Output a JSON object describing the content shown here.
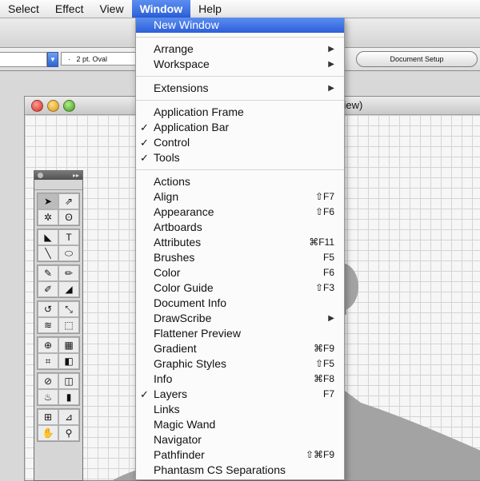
{
  "menubar": {
    "items": [
      "Select",
      "Effect",
      "View",
      "Window",
      "Help"
    ]
  },
  "controlbar": {
    "stroke_label": "2 pt. Oval",
    "document_setup": "Document Setup"
  },
  "document": {
    "title_fragment": "view)"
  },
  "window_menu": {
    "new_window": "New Window",
    "arrange": "Arrange",
    "workspace": "Workspace",
    "extensions": "Extensions",
    "application_frame": "Application Frame",
    "application_bar": "Application Bar",
    "control": "Control",
    "tools": "Tools",
    "panels": [
      {
        "label": "Actions",
        "shortcut": "",
        "checked": false,
        "submenu": false
      },
      {
        "label": "Align",
        "shortcut": "⇧F7",
        "checked": false,
        "submenu": false
      },
      {
        "label": "Appearance",
        "shortcut": "⇧F6",
        "checked": false,
        "submenu": false
      },
      {
        "label": "Artboards",
        "shortcut": "",
        "checked": false,
        "submenu": false
      },
      {
        "label": "Attributes",
        "shortcut": "⌘F11",
        "checked": false,
        "submenu": false
      },
      {
        "label": "Brushes",
        "shortcut": "F5",
        "checked": false,
        "submenu": false
      },
      {
        "label": "Color",
        "shortcut": "F6",
        "checked": false,
        "submenu": false
      },
      {
        "label": "Color Guide",
        "shortcut": "⇧F3",
        "checked": false,
        "submenu": false
      },
      {
        "label": "Document Info",
        "shortcut": "",
        "checked": false,
        "submenu": false
      },
      {
        "label": "DrawScribe",
        "shortcut": "",
        "checked": false,
        "submenu": true
      },
      {
        "label": "Flattener Preview",
        "shortcut": "",
        "checked": false,
        "submenu": false
      },
      {
        "label": "Gradient",
        "shortcut": "⌘F9",
        "checked": false,
        "submenu": false
      },
      {
        "label": "Graphic Styles",
        "shortcut": "⇧F5",
        "checked": false,
        "submenu": false
      },
      {
        "label": "Info",
        "shortcut": "⌘F8",
        "checked": false,
        "submenu": false
      },
      {
        "label": "Layers",
        "shortcut": "F7",
        "checked": true,
        "submenu": false
      },
      {
        "label": "Links",
        "shortcut": "",
        "checked": false,
        "submenu": false
      },
      {
        "label": "Magic Wand",
        "shortcut": "",
        "checked": false,
        "submenu": false
      },
      {
        "label": "Navigator",
        "shortcut": "",
        "checked": false,
        "submenu": false
      },
      {
        "label": "Pathfinder",
        "shortcut": "⇧⌘F9",
        "checked": false,
        "submenu": false
      },
      {
        "label": "Phantasm CS Separations",
        "shortcut": "",
        "checked": false,
        "submenu": false
      }
    ]
  },
  "tool_icons": [
    "selection-tool-icon",
    "direct-selection-tool-icon",
    "magic-wand-tool-icon",
    "lasso-tool-icon",
    "pen-tool-icon",
    "type-tool-icon",
    "line-tool-icon",
    "ellipse-tool-icon",
    "paintbrush-tool-icon",
    "pencil-tool-icon",
    "blob-brush-tool-icon",
    "eraser-tool-icon",
    "rotate-tool-icon",
    "scale-tool-icon",
    "warp-tool-icon",
    "free-transform-tool-icon",
    "shape-builder-tool-icon",
    "perspective-grid-tool-icon",
    "mesh-tool-icon",
    "gradient-tool-icon",
    "eyedropper-tool-icon",
    "blend-tool-icon",
    "symbol-sprayer-tool-icon",
    "column-graph-tool-icon",
    "artboard-tool-icon",
    "slice-tool-icon",
    "hand-tool-icon",
    "zoom-tool-icon"
  ],
  "tool_glyphs": [
    "➤",
    "⇗",
    "✲",
    "ʘ",
    "◣",
    "T",
    "╲",
    "⬭",
    "✎",
    "✏",
    "✐",
    "◢",
    "↺",
    "⤡",
    "≋",
    "⬚",
    "⊕",
    "▦",
    "⌗",
    "◧",
    "⊘",
    "◫",
    "♨",
    "▮",
    "⊞",
    "⊿",
    "✋",
    "⚲"
  ],
  "colors": {
    "highlight": "#2d5fd8",
    "silhouette": "#a3a3a3"
  }
}
